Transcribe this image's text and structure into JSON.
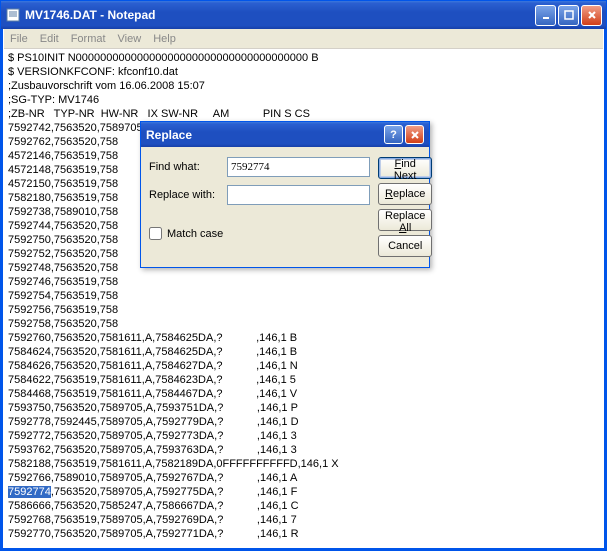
{
  "window": {
    "title": "MV1746.DAT - Notepad"
  },
  "menubar": {
    "items": [
      "File",
      "Edit",
      "Format",
      "View",
      "Help"
    ]
  },
  "dialog": {
    "title": "Replace",
    "find_label": "Find what:",
    "replace_label": "Replace with:",
    "find_value": "7592774",
    "replace_value": "",
    "match_case": "Match case",
    "find_next": "Find Next",
    "replace": "Replace",
    "replace_all": "Replace All",
    "cancel": "Cancel"
  },
  "content": {
    "lines": [
      "$ PS10INIT N00000000000000000000000000000000000000 B",
      "$ VERSIONKFCONF: kfconf10.dat",
      ";Zusbauvorschrift vom 16.06.2008 15:07",
      ";SG-TYP: MV1746",
      ";ZB-NR   TYP-NR  HW-NR   IX SW-NR     AM           PIN S CS",
      "7592742,7563520,7589705,A,7592743DA,?           ,146,1 X",
      "7592762,7563520,758                              ,146,1 X",
      "4572146,7563519,758",
      "4572148,7563519,758",
      "4572150,7563519,758",
      "7582180,7563519,758",
      "7592738,7589010,758",
      "7592744,7563520,758",
      "7592750,7563520,758",
      "7592752,7563520,758",
      "7592748,7563520,758",
      "7592746,7563519,758",
      "7592754,7563519,758",
      "7592756,7563519,758",
      "7592758,7563520,758",
      "7592760,7563520,7581611,A,7584625DA,?           ,146,1 B",
      "7584624,7563520,7581611,A,7584625DA,?           ,146,1 B",
      "7584626,7563520,7581611,A,7584627DA,?           ,146,1 N",
      "7584622,7563519,7581611,A,7584623DA,?           ,146,1 5",
      "7584468,7563519,7581611,A,7584467DA,?           ,146,1 V",
      "7593750,7563520,7589705,A,7593751DA,?           ,146,1 P",
      "7592778,7592445,7589705,A,7592779DA,?           ,146,1 D",
      "7592772,7563520,7589705,A,7592773DA,?           ,146,1 3",
      "7593762,7563520,7589705,A,7593763DA,?           ,146,1 3",
      "7582188,7563519,7581611,A,7582189DA,0FFFFFFFFFFD,146,1 X",
      "7592766,7589010,7589705,A,7592767DA,?           ,146,1 A"
    ],
    "highlight_line": {
      "highlighted": "7592774",
      "rest": ",7563520,7589705,A,7592775DA,?           ,146,1 F"
    },
    "lines_after": [
      "7586666,7563520,7585247,A,7586667DA,?           ,146,1 C",
      "7592768,7563519,7589705,A,7592769DA,?           ,146,1 7",
      "7592770,7563520,7589705,A,7592771DA,?           ,146,1 R"
    ]
  }
}
